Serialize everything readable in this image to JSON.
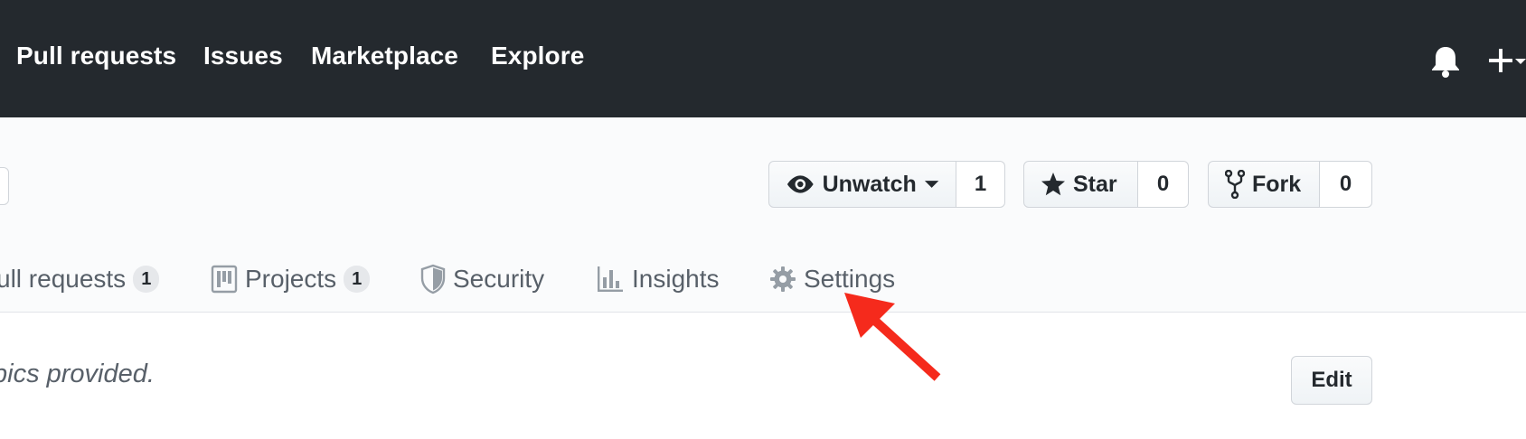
{
  "topnav": {
    "items": [
      "Pull requests",
      "Issues",
      "Marketplace",
      "Explore"
    ],
    "notifications_icon": "bell-icon",
    "create_icon": "plus-dropdown-icon"
  },
  "repo_actions": {
    "watch": {
      "label": "Unwatch",
      "count": "1",
      "icon": "eye-icon"
    },
    "star": {
      "label": "Star",
      "count": "0",
      "icon": "star-icon"
    },
    "fork": {
      "label": "Fork",
      "count": "0",
      "icon": "fork-icon"
    }
  },
  "tabs": [
    {
      "label": "ull requests",
      "counter": "1"
    },
    {
      "label": "Projects",
      "counter": "1",
      "icon": "project-icon"
    },
    {
      "label": "Security",
      "icon": "shield-icon"
    },
    {
      "label": "Insights",
      "icon": "graph-icon"
    },
    {
      "label": "Settings",
      "icon": "gear-icon"
    }
  ],
  "content": {
    "topics_text": "pics provided.",
    "edit_label": "Edit"
  },
  "colors": {
    "header_bg": "#24292e",
    "repohead_bg": "#fafbfc",
    "annotation_arrow": "#f52a1c"
  }
}
